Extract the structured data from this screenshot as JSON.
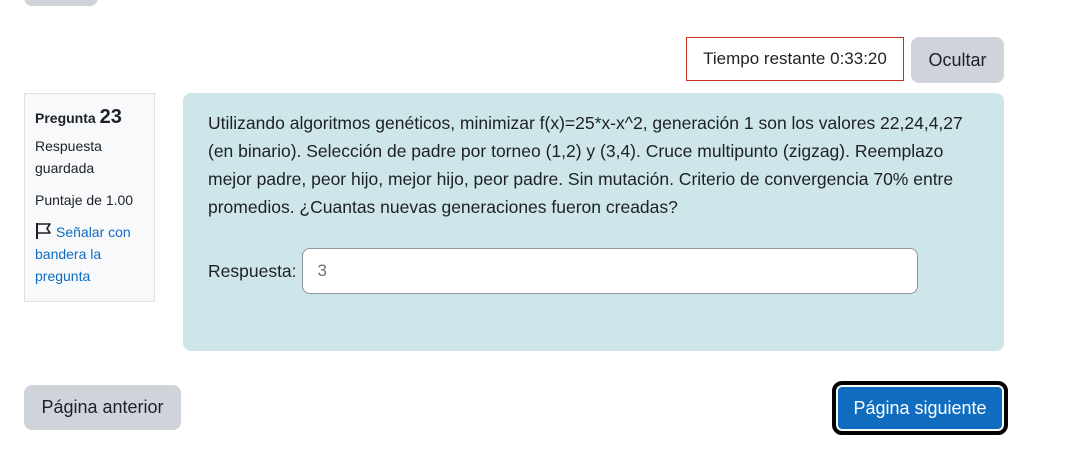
{
  "timer": {
    "label": "Tiempo restante",
    "value": "0:33:20",
    "hide_label": "Ocultar"
  },
  "info": {
    "question_prefix": "Pregunta",
    "question_number": "23",
    "state_line1": "Respuesta",
    "state_line2": "guardada",
    "grade": "Puntaje de 1.00",
    "flag_line1": "Señalar con",
    "flag_line2": "bandera la",
    "flag_line3": "pregunta",
    "flag_icon": "flag-icon"
  },
  "question": {
    "text": "Utilizando algoritmos genéticos, minimizar f(x)=25*x-x^2, generación 1 son los valores 22,24,4,27 (en binario). Selección de padre por torneo (1,2) y (3,4). Cruce multipunto (zigzag). Reemplazo mejor padre, peor hijo, mejor hijo, peor padre. Sin mutación. Criterio de convergencia 70% entre promedios. ¿Cuantas nuevas generaciones fueron creadas?",
    "answer_label": "Respuesta:",
    "answer_value": "3"
  },
  "nav": {
    "prev_label": "Página anterior",
    "next_label": "Página siguiente"
  },
  "colors": {
    "question_bg": "#cee6ea",
    "primary": "#0f6cbf",
    "secondary_btn": "#ced4da",
    "timer_border": "#ca3120"
  }
}
